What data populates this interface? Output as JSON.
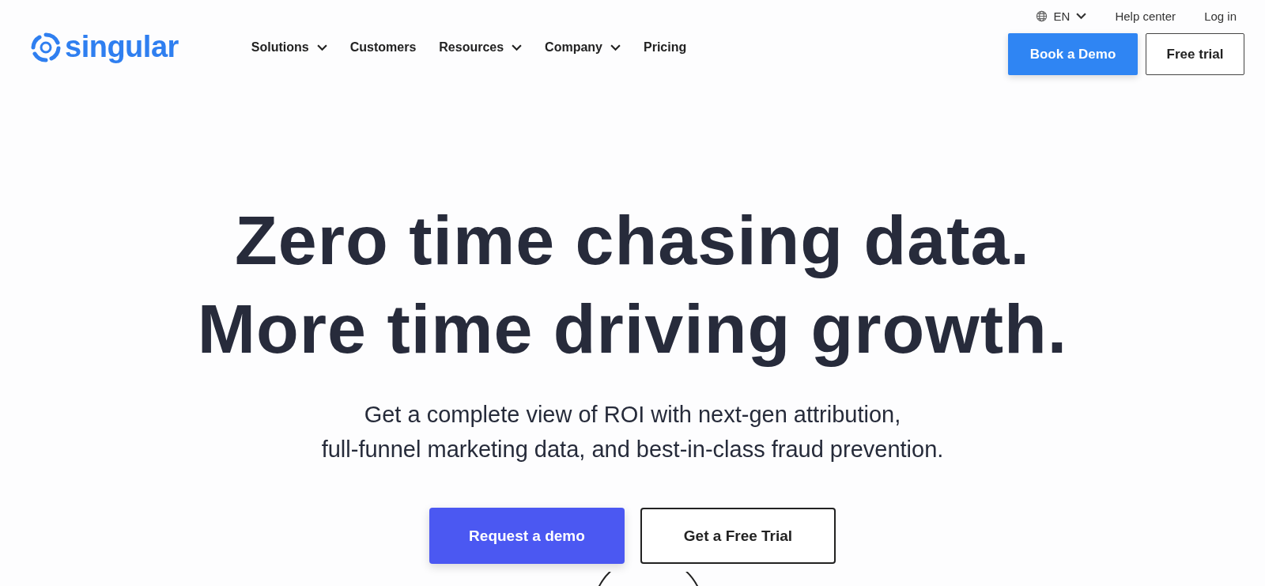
{
  "header": {
    "logo": "singular",
    "nav": [
      {
        "label": "Solutions",
        "dropdown": true
      },
      {
        "label": "Customers",
        "dropdown": false
      },
      {
        "label": "Resources",
        "dropdown": true
      },
      {
        "label": "Company",
        "dropdown": true
      },
      {
        "label": "Pricing",
        "dropdown": false
      }
    ],
    "language": "EN",
    "help_link": "Help center",
    "login_link": "Log in",
    "buttons": [
      {
        "label": "Book a Demo",
        "kind": "primary"
      },
      {
        "label": "Free trial",
        "kind": "outline"
      }
    ]
  },
  "hero": {
    "headline": [
      "Zero time chasing data.",
      "More time driving growth."
    ],
    "subtitle": [
      "Get a complete view of ROI with next-gen attribution,",
      "full-funnel marketing data, and best-in-class fraud prevention."
    ],
    "buttons": [
      {
        "label": "Request a demo",
        "kind": "primary"
      },
      {
        "label": "Get a Free Trial",
        "kind": "outline"
      }
    ]
  }
}
